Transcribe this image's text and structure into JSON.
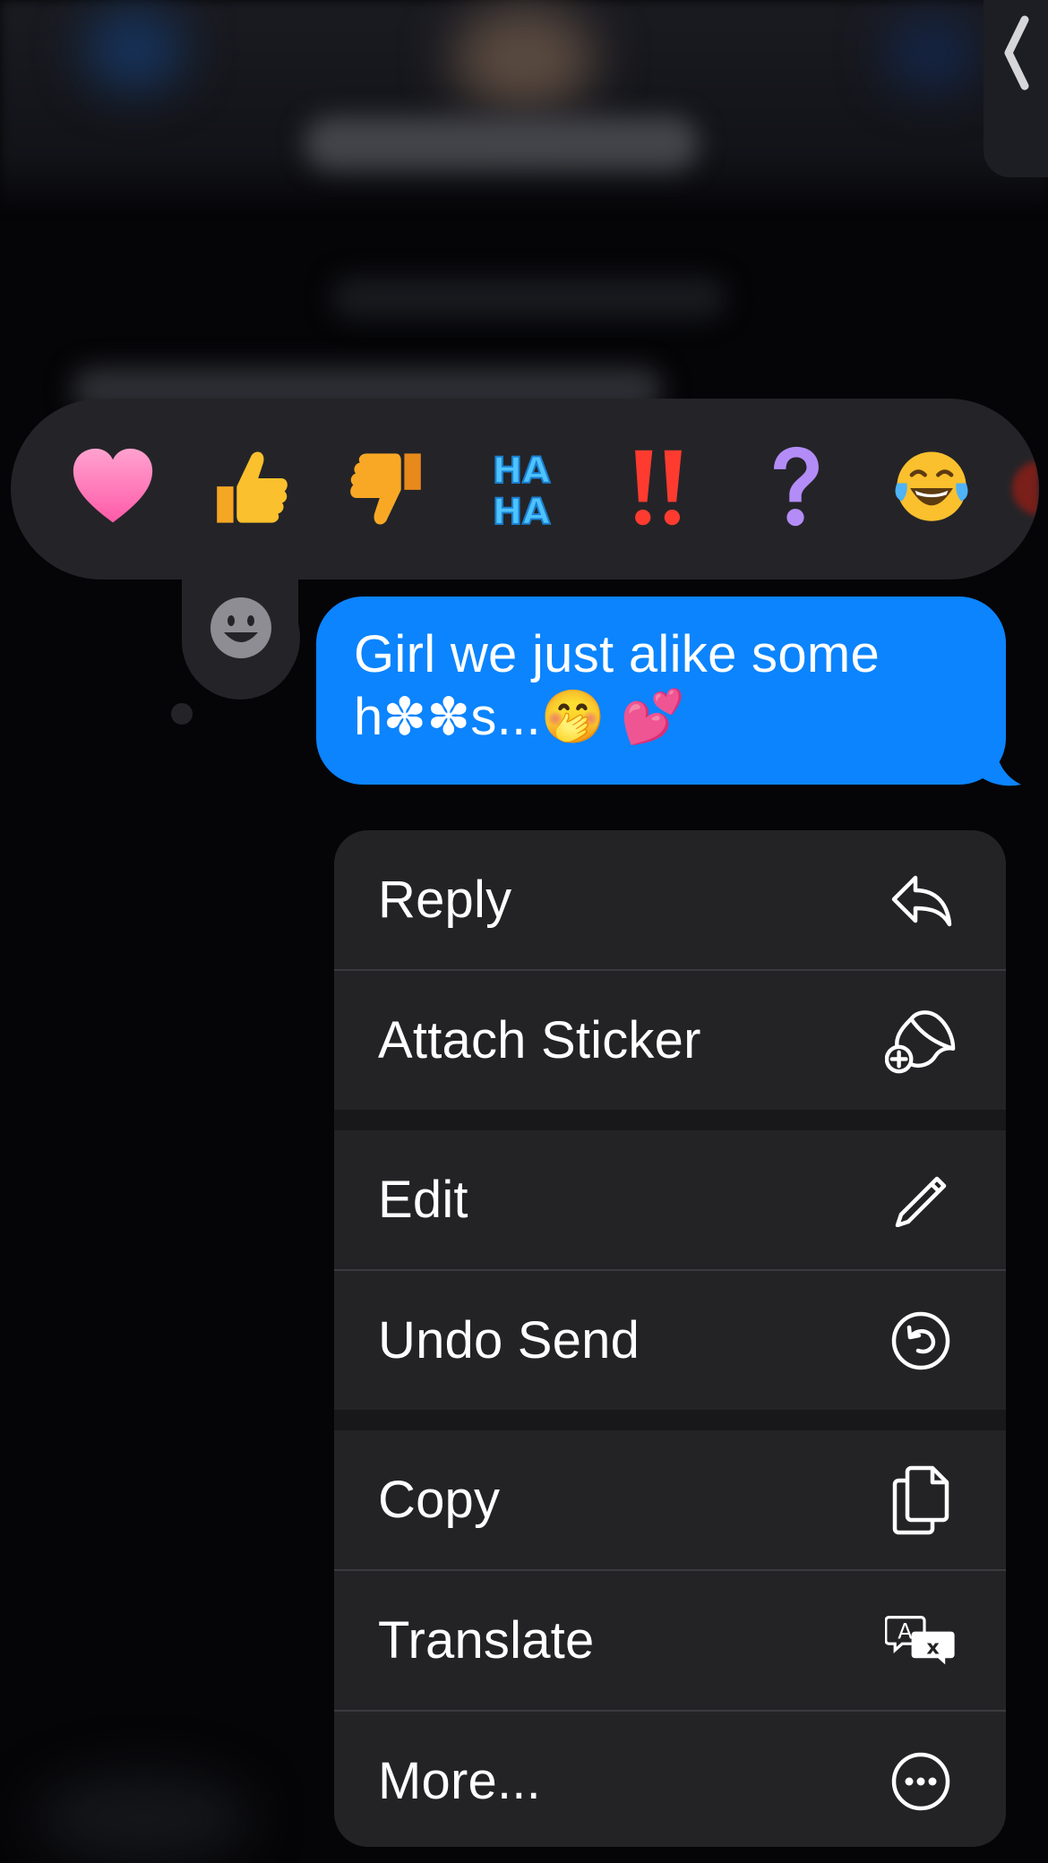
{
  "message": {
    "text_line1": "Girl we just alike some",
    "text_line2": "h✽✽s...🤭 💕",
    "bubble_color": "#0b84fe"
  },
  "reactions": [
    {
      "name": "heart",
      "glyph": "❤️",
      "color": "#ff7fb7"
    },
    {
      "name": "thumbs-up",
      "glyph": "👍",
      "color": "#f7b52a"
    },
    {
      "name": "thumbs-down",
      "glyph": "👎",
      "color": "#f7a22a"
    },
    {
      "name": "haha",
      "glyph": "HA HA",
      "color": "#39b7f5"
    },
    {
      "name": "emphasize",
      "glyph": "‼️",
      "color": "#ff3b30"
    },
    {
      "name": "question",
      "glyph": "?",
      "color": "#b085f5"
    },
    {
      "name": "laughing",
      "glyph": "😂",
      "color": "#fbc531"
    }
  ],
  "menu": {
    "groups": [
      [
        {
          "label": "Reply",
          "icon": "reply-icon"
        },
        {
          "label": "Attach Sticker",
          "icon": "sticker-icon"
        }
      ],
      [
        {
          "label": "Edit",
          "icon": "pencil-icon"
        },
        {
          "label": "Undo Send",
          "icon": "undo-icon"
        }
      ],
      [
        {
          "label": "Copy",
          "icon": "copy-icon"
        },
        {
          "label": "Translate",
          "icon": "translate-icon"
        },
        {
          "label": "More...",
          "icon": "more-icon"
        }
      ]
    ]
  },
  "side_tab": {
    "icon": "chevron-left-icon"
  },
  "sticker_button": {
    "icon": "smiley-face-icon"
  },
  "colors": {
    "menu_bg": "#232326",
    "reaction_bar_bg": "#242428",
    "background": "#050507"
  }
}
